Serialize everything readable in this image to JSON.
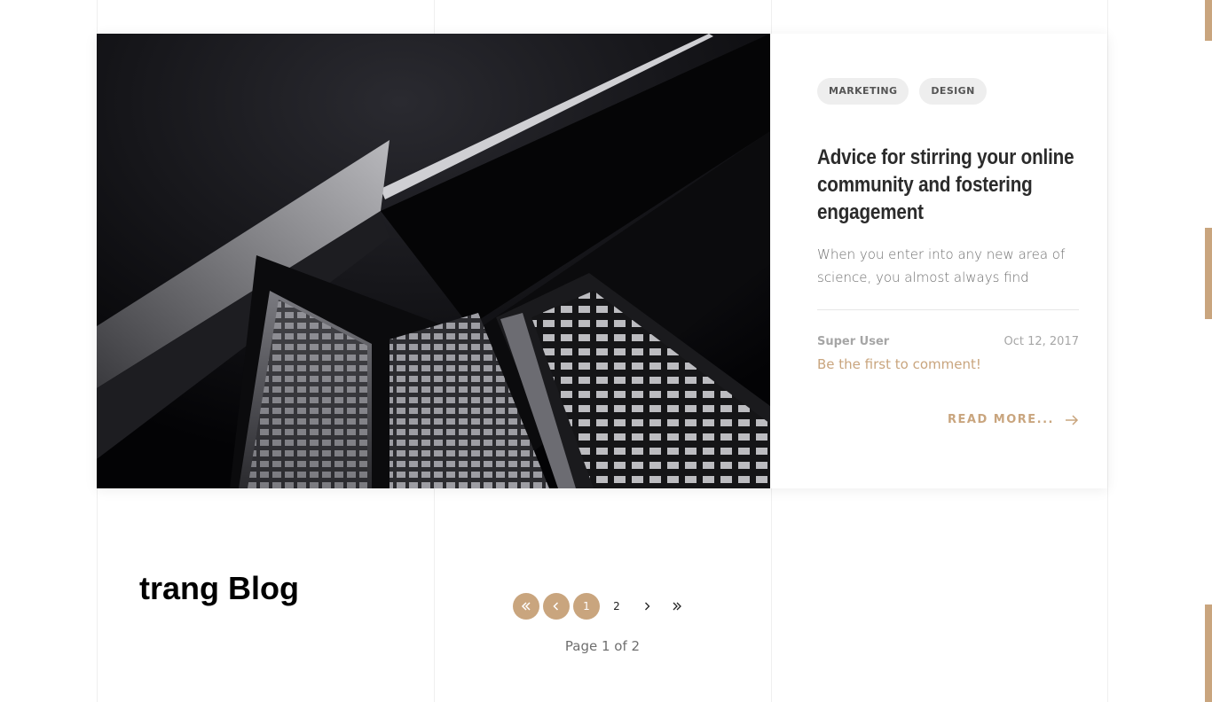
{
  "post": {
    "tags": [
      "MARKETING",
      "DESIGN"
    ],
    "title": "Advice for stirring your online community and fostering engagement",
    "excerpt": "When you enter into any new area of science, you almost always find",
    "author": "Super User",
    "date": "Oct 12, 2017",
    "comment_link": "Be the first to comment!",
    "read_more": "READ MORE..."
  },
  "site": {
    "title": "trang Blog"
  },
  "pagination": {
    "current_page": "1",
    "next_page": "2",
    "summary": "Page 1 of 2"
  },
  "colors": {
    "accent": "#c9a57e",
    "tag_bg": "#eeeeee",
    "title_text": "#2b2b2b",
    "body_text": "#6f6f6f"
  },
  "icons": {
    "first": "double-chevron-left-icon",
    "prev": "chevron-left-icon",
    "next": "chevron-right-icon",
    "last": "double-chevron-right-icon",
    "read_more": "arrow-right-icon"
  }
}
